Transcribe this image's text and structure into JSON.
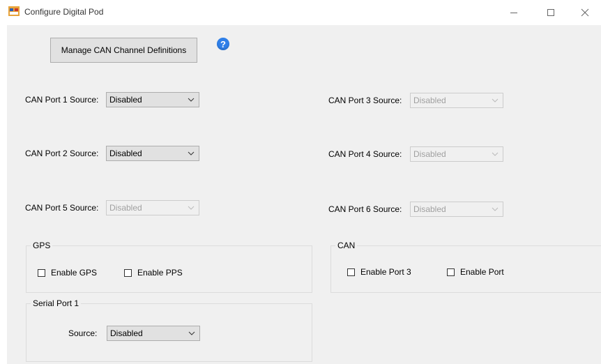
{
  "window": {
    "title": "Configure Digital Pod",
    "controls": [
      "minimize",
      "maximize",
      "close"
    ]
  },
  "toolbar": {
    "manage_button_label": "Manage CAN Channel Definitions",
    "help_glyph": "?"
  },
  "can_ports": [
    {
      "label": "CAN Port 1 Source:",
      "value": "Disabled",
      "enabled": true
    },
    {
      "label": "CAN Port 2 Source:",
      "value": "Disabled",
      "enabled": true
    },
    {
      "label": "CAN Port 5 Source:",
      "value": "Disabled",
      "enabled": false
    },
    {
      "label": "CAN Port 3 Source:",
      "value": "Disabled",
      "enabled": false
    },
    {
      "label": "CAN Port 4 Source:",
      "value": "Disabled",
      "enabled": false
    },
    {
      "label": "CAN Port 6 Source:",
      "value": "Disabled",
      "enabled": false
    }
  ],
  "gps_group": {
    "caption": "GPS",
    "checkboxes": [
      {
        "label": "Enable GPS",
        "checked": false
      },
      {
        "label": "Enable PPS",
        "checked": false
      }
    ]
  },
  "can_group": {
    "caption": "CAN",
    "checkboxes": [
      {
        "label": "Enable Port 3",
        "checked": false
      },
      {
        "label": "Enable Port",
        "checked": false
      }
    ]
  },
  "serial_group": {
    "caption": "Serial Port 1",
    "source_label": "Source:",
    "source_value": "Disabled"
  },
  "colors": {
    "help_icon": "#2f7fe8",
    "disabled_text": "#a0a0a0",
    "client_bg": "#f0f0f0"
  },
  "icons": {
    "app": "app-window-icon",
    "help": "help-icon",
    "dropdown": "chevron-down-icon"
  }
}
